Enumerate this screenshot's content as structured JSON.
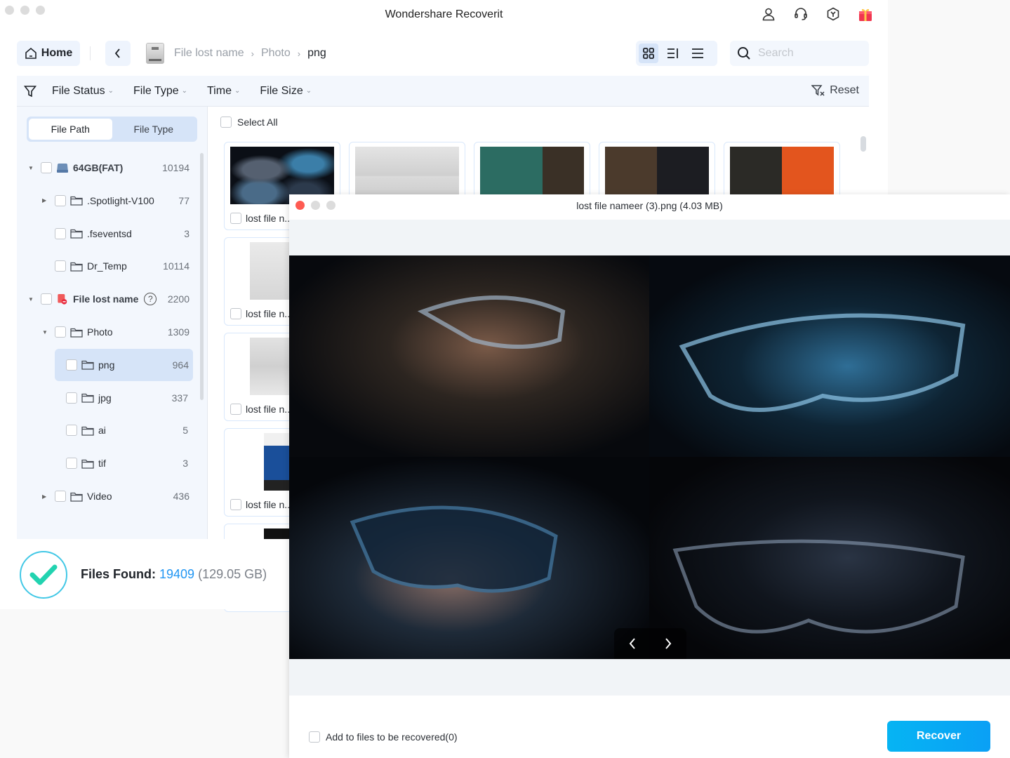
{
  "app": {
    "title": "Wondershare Recoverit",
    "top_icons": [
      "account-icon",
      "support-headset-icon",
      "box-icon",
      "gift-icon"
    ]
  },
  "nav": {
    "home_label": "Home",
    "breadcrumb": [
      "File lost name",
      "Photo",
      "png"
    ],
    "search_placeholder": "Search",
    "search_value": "",
    "view_modes": [
      "grid",
      "detail-list",
      "list"
    ],
    "active_view": "grid"
  },
  "filters": {
    "items": [
      "File Status",
      "File Type",
      "Time",
      "File Size"
    ],
    "reset_label": "Reset"
  },
  "sidebar": {
    "tabs": [
      "File Path",
      "File Type"
    ],
    "active_tab": "File Path",
    "tree": [
      {
        "label": "64GB(FAT)",
        "count": "10194",
        "level": 0,
        "expanded": true,
        "icon": "drive-icon"
      },
      {
        "label": ".Spotlight-V100",
        "count": "77",
        "level": 1,
        "expanded": false,
        "icon": "folder-icon"
      },
      {
        "label": ".fseventsd",
        "count": "3",
        "level": 1,
        "icon": "folder-icon"
      },
      {
        "label": "Dr_Temp",
        "count": "10114",
        "level": 1,
        "icon": "folder-icon"
      },
      {
        "label": "File lost name",
        "count": "2200",
        "level": 0,
        "expanded": true,
        "icon": "lost-file-icon"
      },
      {
        "label": "Photo",
        "count": "1309",
        "level": 1,
        "expanded": true,
        "icon": "folder-icon"
      },
      {
        "label": "png",
        "count": "964",
        "level": 2,
        "selected": true,
        "icon": "folder-icon"
      },
      {
        "label": "jpg",
        "count": "337",
        "level": 2,
        "icon": "folder-icon"
      },
      {
        "label": "ai",
        "count": "5",
        "level": 2,
        "icon": "folder-icon"
      },
      {
        "label": "tif",
        "count": "3",
        "level": 2,
        "icon": "folder-icon"
      },
      {
        "label": "Video",
        "count": "436",
        "level": 1,
        "expanded": false,
        "icon": "folder-icon"
      }
    ]
  },
  "grid": {
    "select_all_label": "Select All",
    "card_caption": "lost file n..."
  },
  "status": {
    "label": "Files Found:",
    "count": "19409",
    "size": "(129.05 GB)"
  },
  "preview": {
    "title": "lost file nameer (3).png (4.03 MB)",
    "add_label": "Add to files to be recovered(0)",
    "recover_label": "Recover"
  },
  "colors": {
    "accent": "#2196f3",
    "recover_button": "#0aa0f5",
    "selected_row": "#d6e4f8",
    "panel_bg": "#f3f7fd",
    "close_dot": "#fe5b52",
    "check_green": "#22d3b0"
  }
}
